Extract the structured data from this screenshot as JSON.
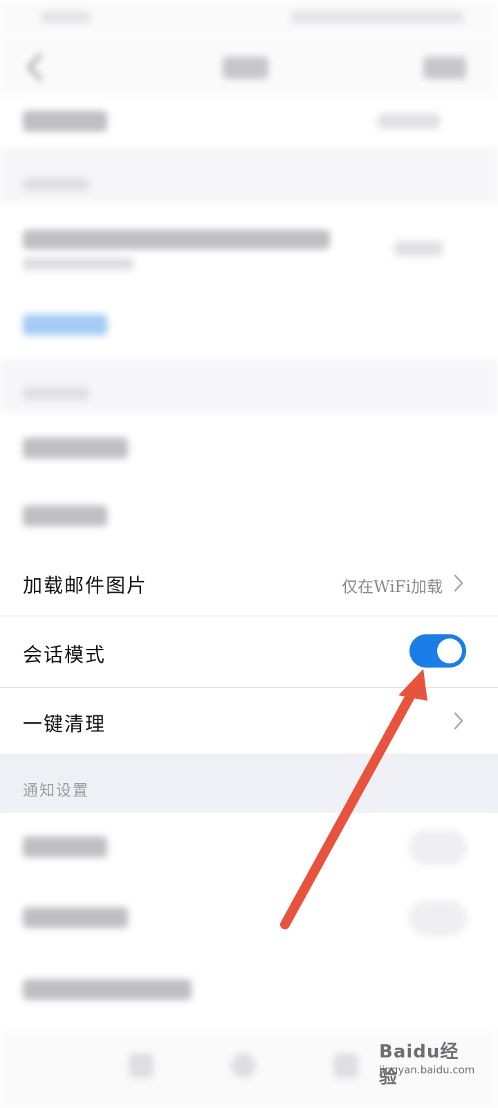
{
  "rows": {
    "load_images": {
      "label": "加载邮件图片",
      "value": "仅在WiFi加载"
    },
    "conversation_mode": {
      "label": "会话模式",
      "toggle_on": true
    },
    "one_click_clean": {
      "label": "一键清理"
    }
  },
  "sections": {
    "notification": {
      "header": "通知设置"
    }
  },
  "watermark": {
    "main": "Baidu经验",
    "sub": "jingyan.baidu.com"
  },
  "colors": {
    "accent": "#1a7ee6",
    "arrow": "#e8533d",
    "section_bg": "#eef0f5"
  },
  "icons": {
    "back": "chevron-left-icon",
    "row_more": "chevron-right-icon"
  }
}
